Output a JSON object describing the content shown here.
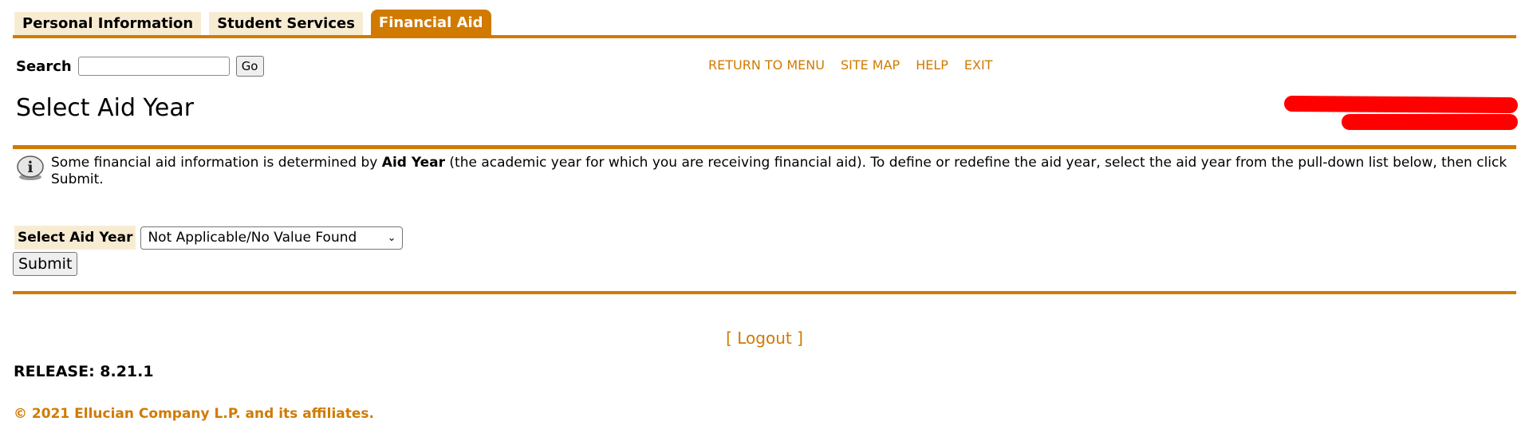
{
  "tabs": [
    {
      "label": "Personal Information",
      "active": false
    },
    {
      "label": "Student Services",
      "active": false
    },
    {
      "label": "Financial Aid",
      "active": true
    }
  ],
  "search": {
    "label": "Search",
    "value": "",
    "placeholder": "",
    "go_label": "Go"
  },
  "top_links": [
    "RETURN TO MENU",
    "SITE MAP",
    "HELP",
    "EXIT"
  ],
  "page_title": "Select Aid Year",
  "info": {
    "text_before": "Some financial aid information is determined by ",
    "bold": "Aid Year",
    "text_after": " (the academic year for which you are receiving financial aid). To define or redefine the aid year, select the aid year from the pull-down list below, then click Submit."
  },
  "form": {
    "label": "Select Aid Year",
    "selected": "Not Applicable/No Value Found",
    "submit_label": "Submit"
  },
  "logout": "[ Logout ]",
  "release": "RELEASE: 8.21.1",
  "copyright": "© 2021 Ellucian Company L.P. and its affiliates.",
  "colors": {
    "accent": "#d17a00",
    "tab_bg": "#f7ecd2",
    "redaction": "#ff0000"
  }
}
